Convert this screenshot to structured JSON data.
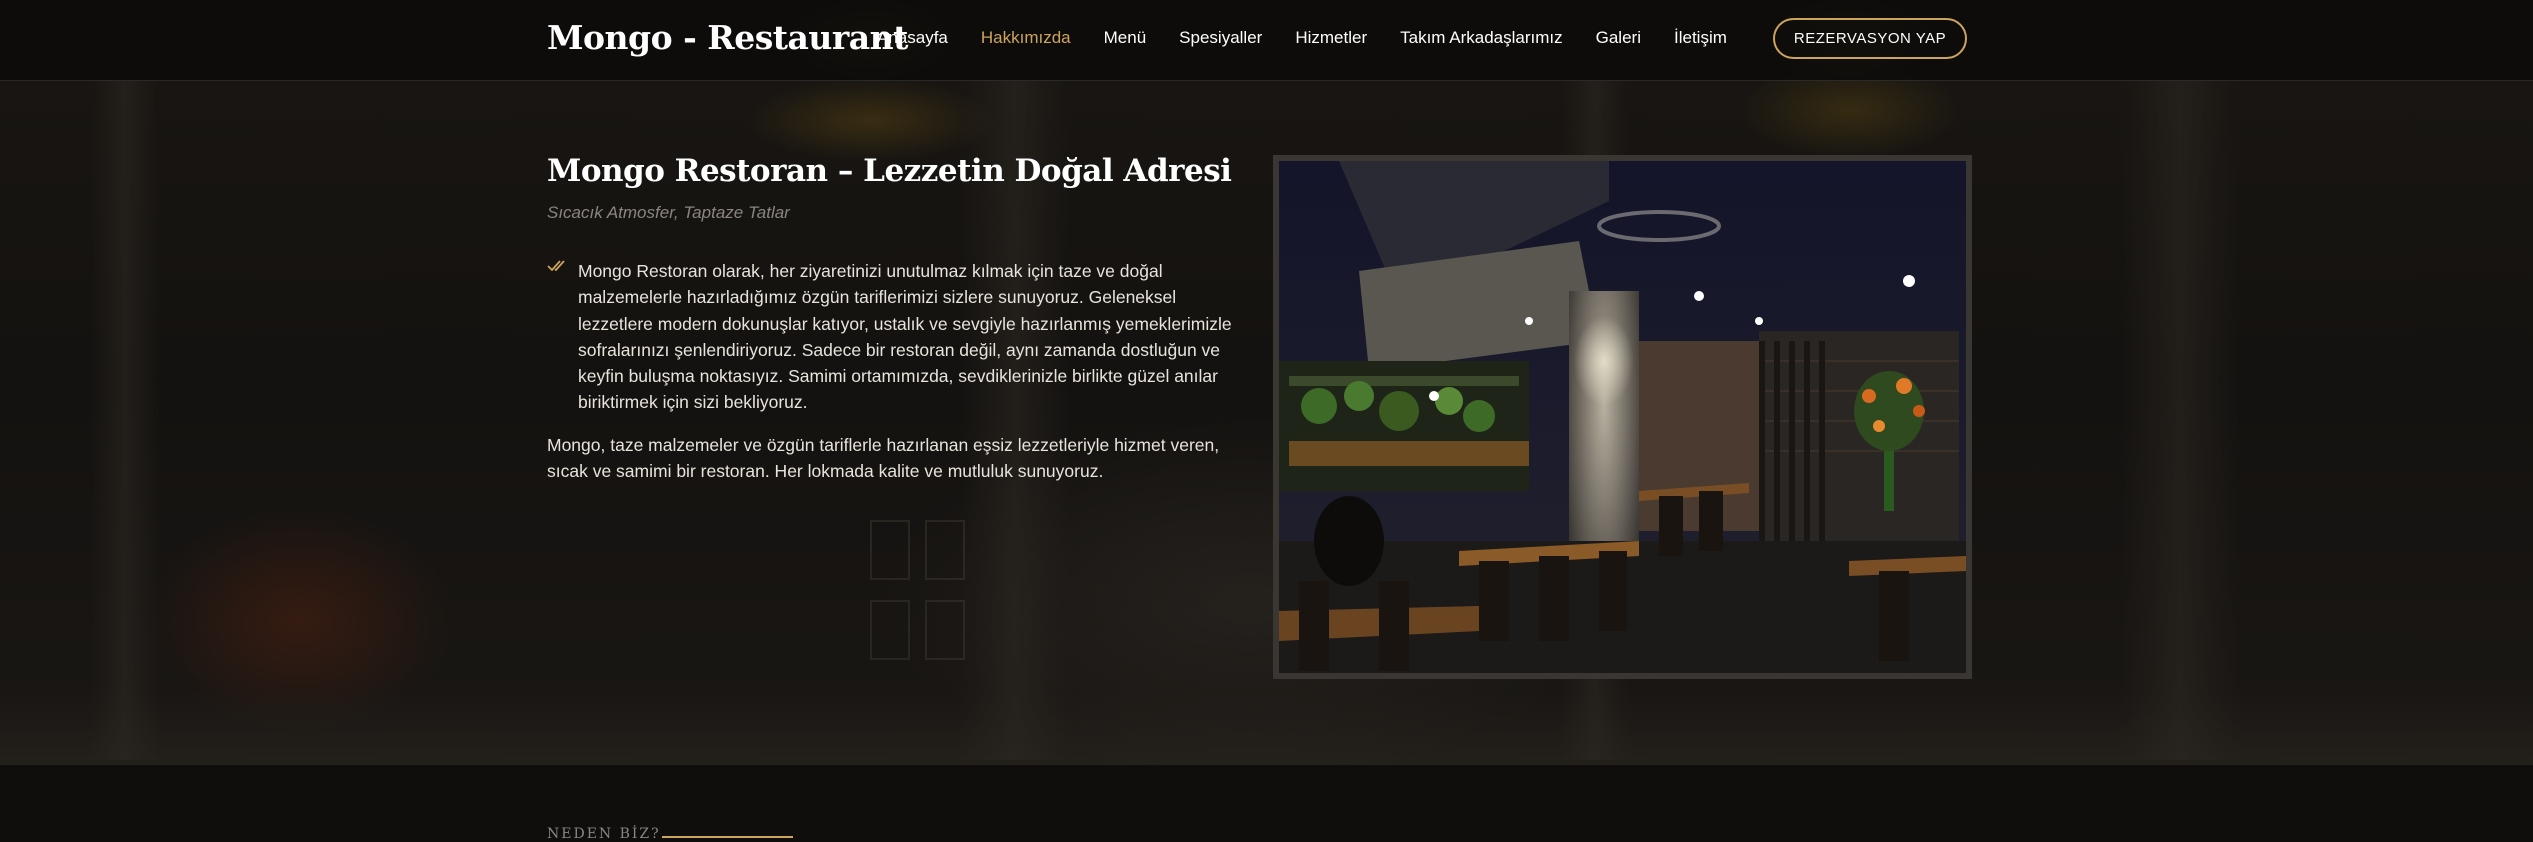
{
  "header": {
    "logo": "Mongo - Restaurant",
    "nav": [
      {
        "label": "Anasayfa",
        "active": false
      },
      {
        "label": "Hakkımızda",
        "active": true
      },
      {
        "label": "Menü",
        "active": false
      },
      {
        "label": "Spesiyaller",
        "active": false
      },
      {
        "label": "Hizmetler",
        "active": false
      },
      {
        "label": "Takım Arkadaşlarımız",
        "active": false
      },
      {
        "label": "Galeri",
        "active": false
      },
      {
        "label": "İletişim",
        "active": false
      }
    ],
    "cta_label": "REZERVASYON YAP"
  },
  "about": {
    "title": "Mongo Restoran – Lezzetin Doğal Adresi",
    "subtitle": "Sıcacık Atmosfer, Taptaze Tatlar",
    "bullet": "Mongo Restoran olarak, her ziyaretinizi unutulmaz kılmak için taze ve doğal malzemelerle hazırladığımız özgün tariflerimizi sizlere sunuyoruz. Geleneksel lezzetlere modern dokunuşlar katıyor, ustalık ve sevgiyle hazırlanmış yemeklerimizle sofralarınızı şenlendiriyoruz. Sadece bir restoran değil, aynı zamanda dostluğun ve keyfin buluşma noktasıyız. Samimi ortamımızda, sevdiklerinizle birlikte güzel anılar biriktirmek için sizi bekliyoruz.",
    "paragraph": "Mongo, taze malzemeler ve özgün tariflerle hazırlanan eşsiz lezzetleriyle hizmet veren, sıcak ve samimi bir restoran. Her lokmada kalite ve mutluluk sunuyoruz."
  },
  "why": {
    "label": "NEDEN BİZ?"
  },
  "colors": {
    "accent": "#cda45e",
    "background": "#0c0b0a",
    "text": "#e8e4dc"
  },
  "icons": {
    "bullet": "double-check-icon"
  }
}
